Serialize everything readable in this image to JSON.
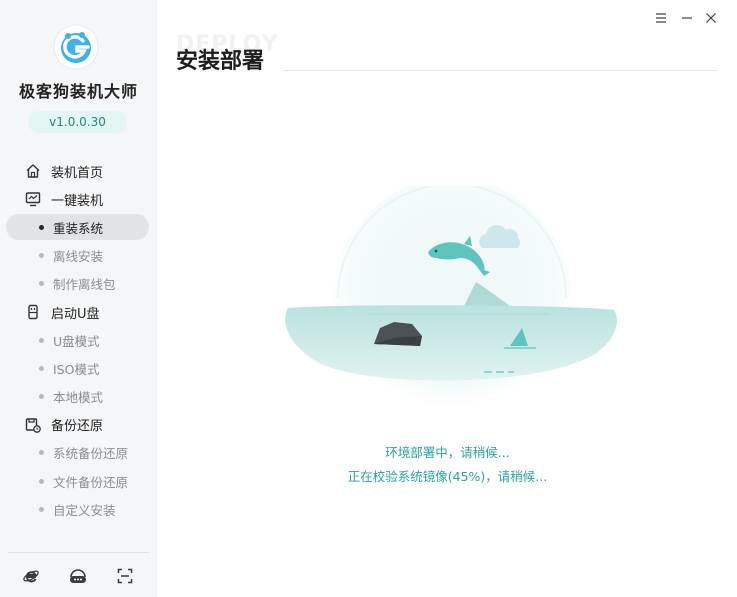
{
  "app": {
    "name": "极客狗装机大师",
    "version": "v1.0.0.30"
  },
  "nav": {
    "home": "装机首页",
    "one_click": "一键装机",
    "reinstall": "重装系统",
    "offline_install": "离线安装",
    "make_offline_pkg": "制作离线包",
    "boot_usb": "启动U盘",
    "usb_mode": "U盘模式",
    "iso_mode": "ISO模式",
    "local_mode": "本地模式",
    "backup_restore": "备份还原",
    "system_backup": "系统备份还原",
    "file_backup": "文件备份还原",
    "custom_install": "自定义安装"
  },
  "main": {
    "ghost_title": "DEPLOY",
    "title": "安装部署",
    "status_line1": "环境部署中，请稍候...",
    "status_line2": "正在校验系统镜像(45%)，请稍候..."
  },
  "progress": {
    "verify_percent": 45
  },
  "icons": {
    "menu": "menu-icon",
    "minimize": "minimize-icon",
    "close": "close-icon",
    "home": "home-icon",
    "monitor": "monitor-icon",
    "usb": "usb-icon",
    "backup": "backup-icon",
    "browser": "ie-icon",
    "support": "headset-icon",
    "screenshot": "scan-icon"
  },
  "colors": {
    "accent": "#2aa3a0",
    "version_bg": "#e3f6f2",
    "active_bg": "#e2e3e5",
    "sidebar_bg": "#f5f6f7"
  }
}
